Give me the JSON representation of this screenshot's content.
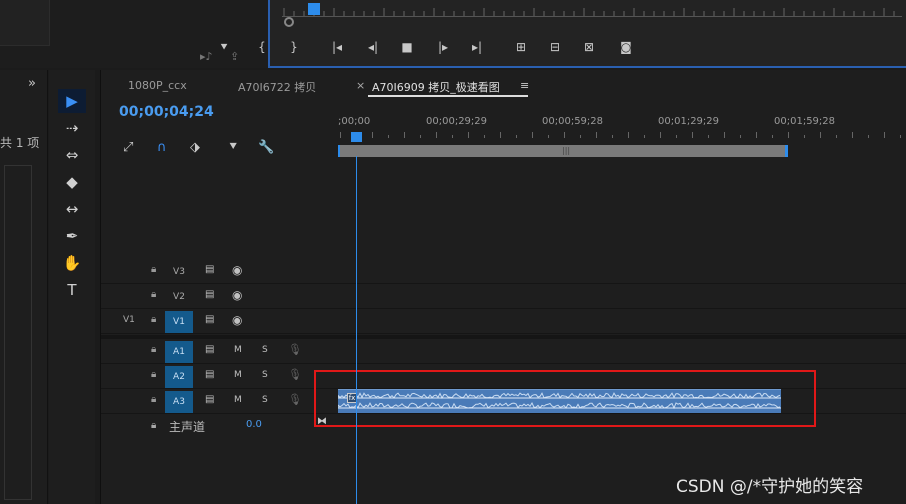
{
  "program_monitor": {
    "controls": [
      "marker-icon",
      "in-point-icon",
      "out-point-icon",
      "go-to-in-icon",
      "step-back-icon",
      "stop-icon",
      "step-forward-icon",
      "go-to-out-icon",
      "insert-icon",
      "overwrite-icon",
      "lift-icon",
      "camera-icon"
    ],
    "control_glyphs": [
      "⯆",
      "{",
      "}",
      "|◂",
      "◂|",
      "■",
      "|▸",
      "▸|",
      "⊞",
      "⊟",
      "⊠",
      "◙"
    ]
  },
  "left_panel": {
    "chevron": "»",
    "item_count": "共 1 项"
  },
  "tools": [
    "▶",
    "⇢",
    "⇔",
    "◆",
    "↔",
    "✒",
    "✋",
    "T"
  ],
  "timeline": {
    "tabs": [
      "1080P_ccx",
      "A70I6722 拷贝",
      "A70I6909 拷贝_极速看图"
    ],
    "tab_close": "×",
    "tab_menu": "≡",
    "timecode": "00;00;04;24",
    "ruler_labels": [
      ";00;00",
      "00;00;29;29",
      "00;00;59;28",
      "00;01;29;29",
      "00;01;59;28"
    ],
    "tools_glyphs": [
      "⤢",
      "∩",
      "⬗",
      "⯆",
      "🔧"
    ],
    "range_grip": "|||",
    "video_tracks": [
      {
        "name": "V3",
        "source": ""
      },
      {
        "name": "V2",
        "source": ""
      },
      {
        "name": "V1",
        "source": "V1"
      }
    ],
    "audio_tracks": [
      {
        "name": "A1",
        "m": "M",
        "s": "S"
      },
      {
        "name": "A2",
        "m": "M",
        "s": "S"
      },
      {
        "name": "A3",
        "m": "M",
        "s": "S"
      }
    ],
    "master": {
      "label": "主声道",
      "value": "0.0"
    },
    "clip_badge": "fx"
  },
  "watermark": "CSDN @/*守护她的笑容",
  "colors": {
    "accent": "#2d8ceb",
    "track_on": "#145a8c",
    "clip": "#4a7bb8",
    "highlight_box": "#e01818"
  }
}
